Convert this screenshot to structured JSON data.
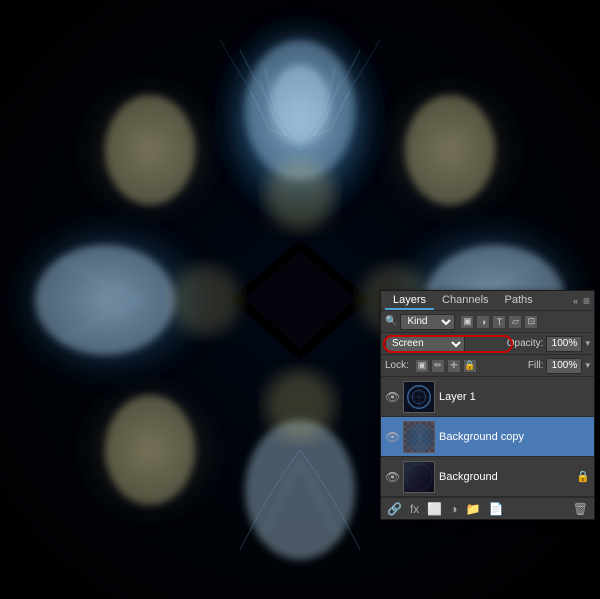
{
  "panel": {
    "title": "Layers",
    "tabs": [
      "Layers",
      "Channels",
      "Paths"
    ],
    "active_tab": "Layers"
  },
  "filter_row": {
    "search_label": "🔍",
    "kind_select": "Kind",
    "filter_icons": [
      "pixel-icon",
      "adjustment-icon",
      "type-icon",
      "shape-icon",
      "smart-object-icon"
    ]
  },
  "blend_row": {
    "blend_label": "Screen",
    "opacity_label": "Opacity:",
    "opacity_value": "100%"
  },
  "lock_row": {
    "lock_label": "Lock:",
    "fill_label": "Fill:",
    "fill_value": "100%"
  },
  "layers": [
    {
      "name": "Layer 1",
      "visible": true,
      "selected": false,
      "has_lock": false,
      "thumb_type": "layer1"
    },
    {
      "name": "Background copy",
      "visible": true,
      "selected": true,
      "has_lock": false,
      "thumb_type": "bg-copy"
    },
    {
      "name": "Background",
      "visible": true,
      "selected": false,
      "has_lock": true,
      "thumb_type": "bg"
    }
  ],
  "footer": {
    "buttons": [
      "link-icon",
      "fx-icon",
      "adjustment-icon",
      "mask-icon",
      "folder-icon",
      "trash-icon"
    ]
  }
}
